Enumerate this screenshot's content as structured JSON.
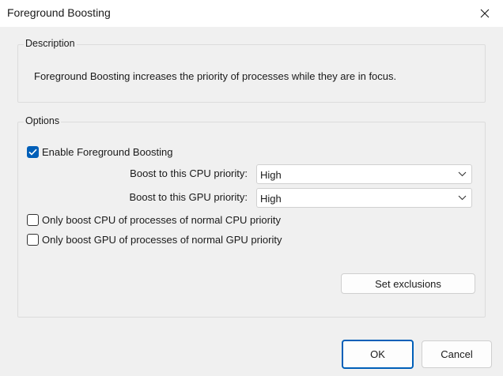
{
  "window": {
    "title": "Foreground Boosting"
  },
  "description": {
    "legend": "Description",
    "text": "Foreground Boosting increases the priority of processes while they are in focus."
  },
  "options": {
    "legend": "Options",
    "enable_boost": {
      "label": "Enable Foreground Boosting",
      "checked": true
    },
    "cpu_priority": {
      "label": "Boost to this CPU priority:",
      "value": "High"
    },
    "gpu_priority": {
      "label": "Boost to this GPU priority:",
      "value": "High"
    },
    "only_cpu_normal": {
      "label": "Only boost CPU of processes of normal CPU priority",
      "checked": false
    },
    "only_gpu_normal": {
      "label": "Only boost GPU of processes of normal GPU priority",
      "checked": false
    },
    "set_exclusions_label": "Set exclusions"
  },
  "footer": {
    "ok_label": "OK",
    "cancel_label": "Cancel"
  },
  "colors": {
    "accent": "#005fb8"
  }
}
